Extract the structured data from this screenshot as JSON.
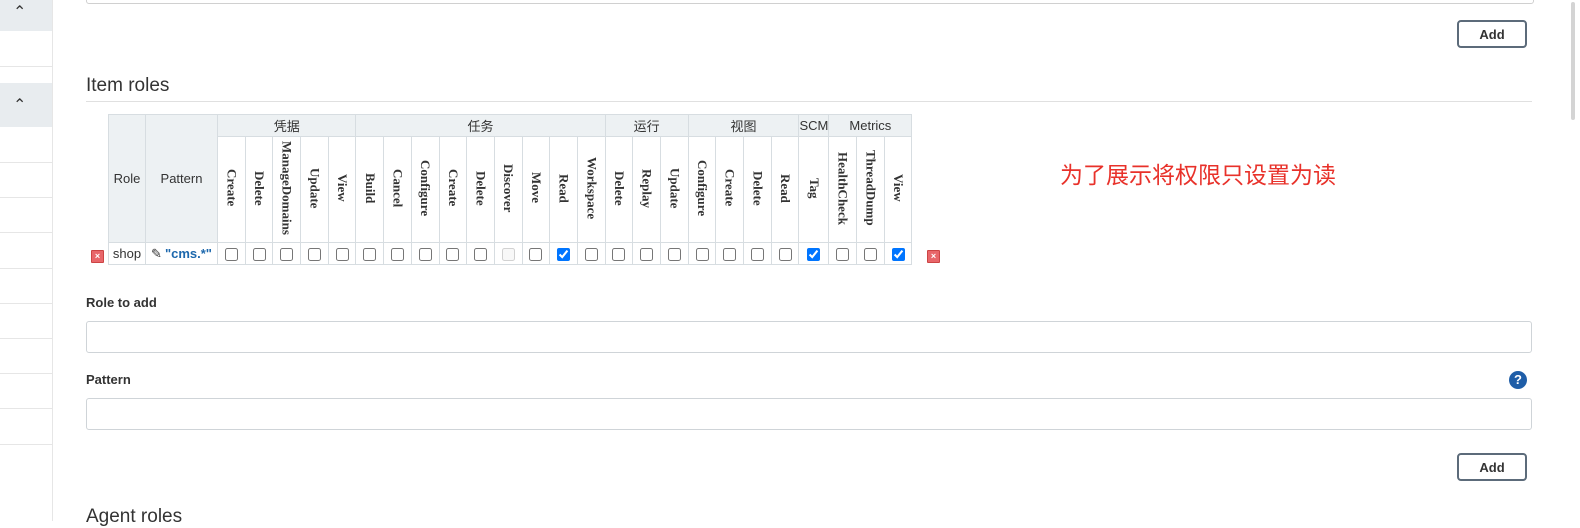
{
  "top_add_button": "Add",
  "item_roles": {
    "title": "Item roles",
    "columns": {
      "role": "Role",
      "pattern": "Pattern"
    },
    "groups": [
      {
        "name": "凭据",
        "perms": [
          "Create",
          "Delete",
          "ManageDomains",
          "Update",
          "View"
        ]
      },
      {
        "name": "任务",
        "perms": [
          "Build",
          "Cancel",
          "Configure",
          "Create",
          "Delete",
          "Discover",
          "Move",
          "Read",
          "Workspace"
        ]
      },
      {
        "name": "运行",
        "perms": [
          "Delete",
          "Replay",
          "Update"
        ]
      },
      {
        "name": "视图",
        "perms": [
          "Configure",
          "Create",
          "Delete",
          "Read"
        ]
      },
      {
        "name": "SCM",
        "perms": [
          "Tag"
        ]
      },
      {
        "name": "Metrics",
        "perms": [
          "HealthCheck",
          "ThreadDump",
          "View"
        ]
      }
    ],
    "rows": [
      {
        "role": "shop",
        "pattern": "\"cms.*\"",
        "checked": [
          false,
          false,
          false,
          false,
          false,
          false,
          false,
          false,
          false,
          false,
          false,
          false,
          true,
          false,
          false,
          false,
          false,
          false,
          false,
          false,
          false,
          true,
          false,
          false,
          true
        ],
        "disabled": [
          10
        ]
      }
    ]
  },
  "annotation": "为了展示将权限只设置为读",
  "role_to_add": {
    "label": "Role to add",
    "value": ""
  },
  "pattern_field": {
    "label": "Pattern",
    "value": ""
  },
  "bottom_add_button": "Add",
  "next_section_title": "Agent roles"
}
